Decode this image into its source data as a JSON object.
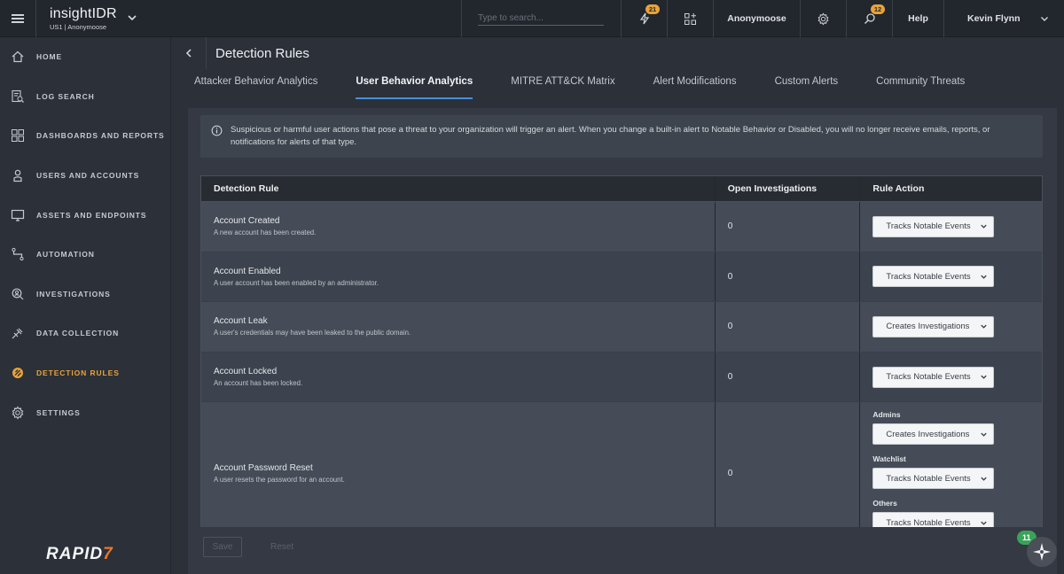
{
  "app": {
    "name": "insightIDR",
    "region": "US1 | Anonymoose"
  },
  "search": {
    "placeholder": "Type to search..."
  },
  "notifications": {
    "alerts_count": "21",
    "messages_count": "12"
  },
  "topbar": {
    "org": "Anonymoose",
    "help": "Help",
    "user": "Kevin Flynn"
  },
  "sidebar": {
    "items": [
      {
        "label": "HOME",
        "icon": "home-icon"
      },
      {
        "label": "LOG SEARCH",
        "icon": "log-search-icon"
      },
      {
        "label": "DASHBOARDS AND REPORTS",
        "icon": "dashboard-icon"
      },
      {
        "label": "USERS AND ACCOUNTS",
        "icon": "user-icon"
      },
      {
        "label": "ASSETS AND ENDPOINTS",
        "icon": "monitor-icon"
      },
      {
        "label": "AUTOMATION",
        "icon": "automation-icon"
      },
      {
        "label": "INVESTIGATIONS",
        "icon": "investigation-icon"
      },
      {
        "label": "DATA COLLECTION",
        "icon": "plug-icon"
      },
      {
        "label": "DETECTION RULES",
        "icon": "detection-icon",
        "active": true
      },
      {
        "label": "SETTINGS",
        "icon": "gear-icon"
      }
    ],
    "brand": "RAPID",
    "brand_mark": "7"
  },
  "page": {
    "title": "Detection Rules"
  },
  "tabs": [
    {
      "label": "Attacker Behavior Analytics"
    },
    {
      "label": "User Behavior Analytics",
      "active": true
    },
    {
      "label": "MITRE ATT&CK Matrix"
    },
    {
      "label": "Alert Modifications"
    },
    {
      "label": "Custom Alerts"
    },
    {
      "label": "Community Threats"
    }
  ],
  "info_text": "Suspicious or harmful user actions that pose a threat to your organization will trigger an alert. When you change a built-in alert to Notable Behavior or Disabled, you will no longer receive emails, reports, or notifications for alerts of that type.",
  "table": {
    "headers": {
      "rule": "Detection Rule",
      "open": "Open Investigations",
      "action": "Rule Action"
    },
    "rows": [
      {
        "name": "Account Created",
        "desc": "A new account has been created.",
        "open": "0",
        "action": "Tracks Notable Events"
      },
      {
        "name": "Account Enabled",
        "desc": "A user account has been enabled by an administrator.",
        "open": "0",
        "action": "Tracks Notable Events"
      },
      {
        "name": "Account Leak",
        "desc": "A user's credentials may have been leaked to the public domain.",
        "open": "0",
        "action": "Creates Investigations"
      },
      {
        "name": "Account Locked",
        "desc": "An account has been locked.",
        "open": "0",
        "action": "Tracks Notable Events"
      },
      {
        "name": "Account Password Reset",
        "desc": "A user resets the password for an account.",
        "open": "0",
        "groups": [
          {
            "label": "Admins",
            "action": "Creates Investigations"
          },
          {
            "label": "Watchlist",
            "action": "Tracks Notable Events"
          },
          {
            "label": "Others",
            "action": "Tracks Notable Events"
          }
        ]
      }
    ]
  },
  "footer": {
    "save": "Save",
    "reset": "Reset"
  },
  "assistant": {
    "badge": "11"
  },
  "colors": {
    "accent": "#e8a33a",
    "tab_underline": "#4a8fd9",
    "brand_seven": "#e8772e",
    "badge_green": "#3aa35a"
  }
}
